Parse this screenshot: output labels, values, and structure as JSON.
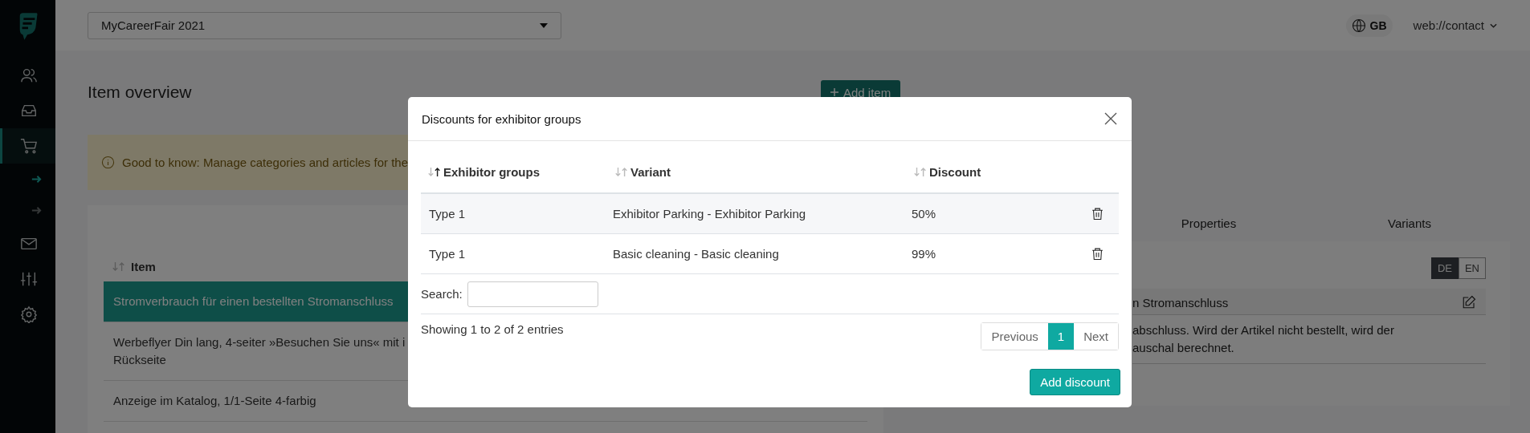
{
  "sidebar": {
    "items": [
      {
        "kind": "main",
        "selected": false
      },
      {
        "kind": "main",
        "selected": false
      },
      {
        "kind": "main",
        "selected": true
      },
      {
        "kind": "sub",
        "selected": true
      },
      {
        "kind": "sub",
        "selected": false
      },
      {
        "kind": "main",
        "selected": false
      },
      {
        "kind": "main",
        "selected": false
      },
      {
        "kind": "main",
        "selected": false
      }
    ]
  },
  "header": {
    "event_select": "MyCareerFair 2021",
    "language": "GB",
    "account": "web://contact"
  },
  "page": {
    "title": "Item overview",
    "add_button": "Add item",
    "notice": "Good to know: Manage categories and articles for the"
  },
  "items_table": {
    "column": "Item",
    "rows": [
      {
        "text": "Stromverbrauch für einen bestellten Stromanschluss",
        "selected": true
      },
      {
        "text": "Werbeflyer Din lang, 4-seiter »Besuchen Sie uns« mit i",
        "line_2": "Rückseite",
        "selected": false
      },
      {
        "text": "Anzeige im Katalog, 1/1-Seite 4-farbig",
        "selected": false
      }
    ]
  },
  "detail": {
    "tabs": [
      {
        "label": "Properties"
      },
      {
        "label": "Variants"
      }
    ],
    "languages": [
      {
        "label": "DE",
        "selected": true
      },
      {
        "label": "EN",
        "selected": false
      }
    ],
    "name_fragment": "n Stromanschluss",
    "description_lines": [
      "abschluss. Wird der Artikel nicht bestellt, wird der",
      "auschal berechnet."
    ]
  },
  "modal": {
    "title": "Discounts for exhibitor groups",
    "columns": [
      {
        "label": "Exhibitor groups",
        "sorted": true
      },
      {
        "label": "Variant",
        "sorted": false
      },
      {
        "label": "Discount",
        "sorted": false
      }
    ],
    "rows": [
      {
        "group": "Type 1",
        "variant": "Exhibitor Parking - Exhibitor Parking",
        "discount": "50%"
      },
      {
        "group": "Type 1",
        "variant": "Basic cleaning - Basic cleaning",
        "discount": "99%"
      }
    ],
    "search_label": "Search:",
    "info": "Showing 1 to 2 of 2 entries",
    "pagination": [
      {
        "label": "Previous",
        "selected": false
      },
      {
        "label": "1",
        "selected": true
      },
      {
        "label": "Next",
        "selected": false
      }
    ],
    "add_button": "Add discount"
  }
}
